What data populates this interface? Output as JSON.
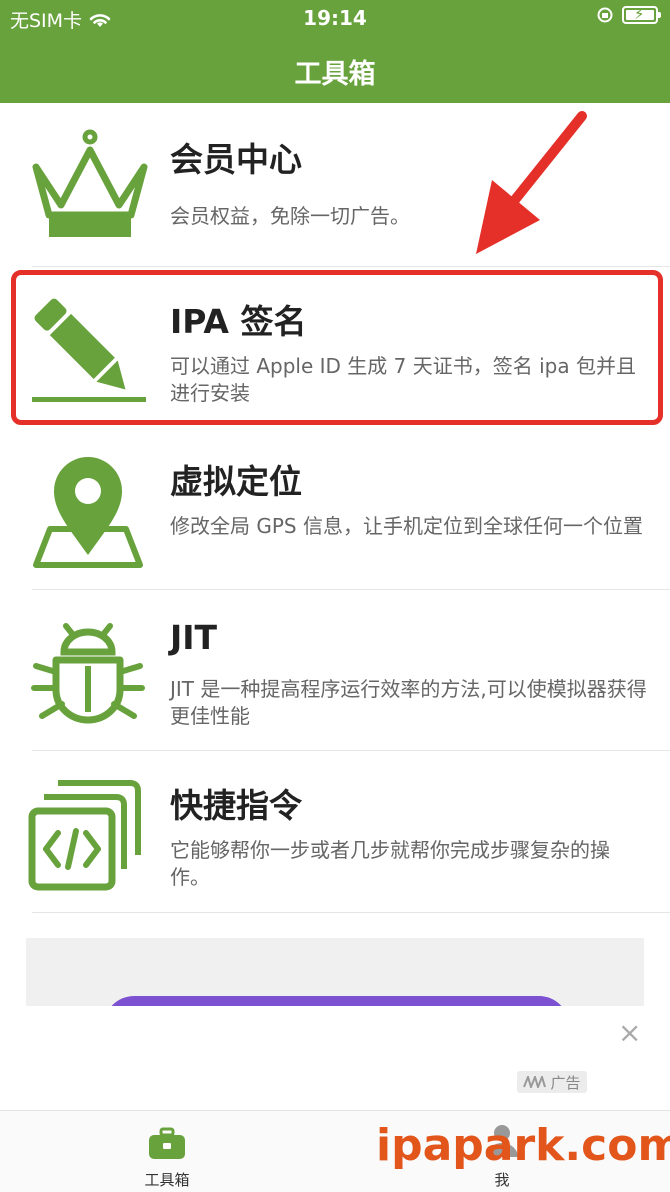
{
  "status_bar": {
    "carrier": "无SIM卡",
    "time": "19:14"
  },
  "header": {
    "title": "工具箱"
  },
  "items": [
    {
      "title": "会员中心",
      "desc": "会员权益，免除一切广告。",
      "icon": "crown-icon"
    },
    {
      "title": "IPA 签名",
      "desc": "可以通过 Apple ID 生成 7 天证书，签名 ipa 包并且进行安装",
      "icon": "pencil-icon"
    },
    {
      "title": "虚拟定位",
      "desc": "修改全局 GPS 信息，让手机定位到全球任何一个位置",
      "icon": "location-pin-icon"
    },
    {
      "title": "JIT",
      "desc": "JIT 是一种提高程序运行效率的方法,可以使模拟器获得更佳性能",
      "icon": "bug-icon"
    },
    {
      "title": "快捷指令",
      "desc": "它能够帮你一步或者几步就帮你完成步骤复杂的操作。",
      "icon": "shortcuts-icon"
    }
  ],
  "ad": {
    "label": "广告",
    "close": "×"
  },
  "tabbar": {
    "tabs": [
      {
        "label": "工具箱",
        "icon": "toolbox-icon",
        "active": true
      },
      {
        "label": "我",
        "icon": "person-icon",
        "active": false
      }
    ]
  },
  "watermark": "ipapark.com",
  "colors": {
    "accent": "#68a23c",
    "highlight": "#e5302a",
    "ad_pill": "#7c52d3"
  }
}
